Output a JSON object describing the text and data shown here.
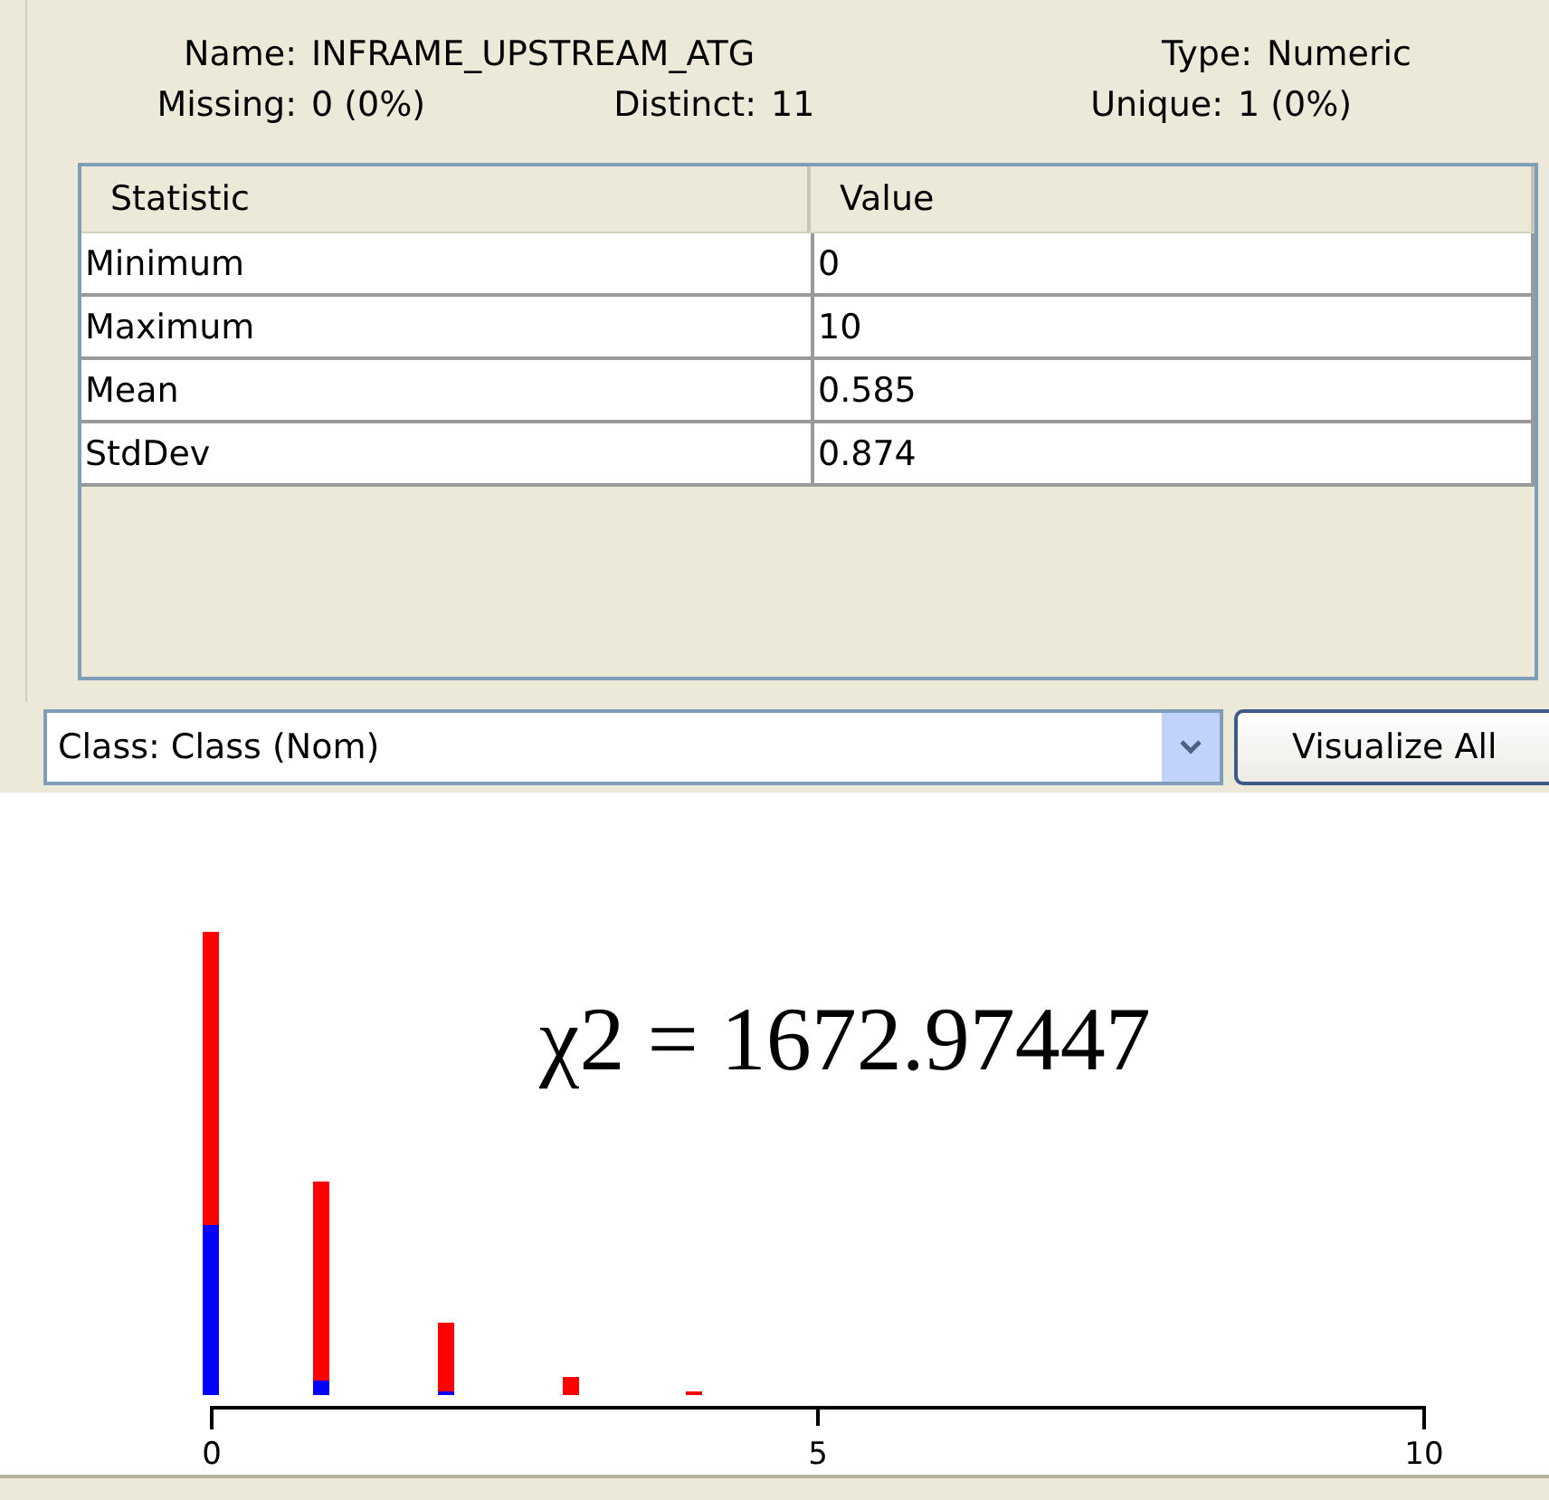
{
  "attribute": {
    "name_label": "Name:",
    "name": "INFRAME_UPSTREAM_ATG",
    "type_label": "Type:",
    "type": "Numeric",
    "missing_label": "Missing:",
    "missing": "0 (0%)",
    "distinct_label": "Distinct:",
    "distinct": "11",
    "unique_label": "Unique:",
    "unique": "1 (0%)"
  },
  "table": {
    "columns": [
      "Statistic",
      "Value"
    ],
    "rows": [
      [
        "Minimum",
        "0"
      ],
      [
        "Maximum",
        "10"
      ],
      [
        "Mean",
        "0.585"
      ],
      [
        "StdDev",
        "0.874"
      ]
    ]
  },
  "class_dropdown": {
    "value": "Class: Class (Nom)"
  },
  "buttons": [
    "Visualize All"
  ],
  "histogram": {
    "annotation": "χ2 = 1672.97447",
    "axis_ticks": [
      "0",
      "5",
      "10"
    ]
  }
}
